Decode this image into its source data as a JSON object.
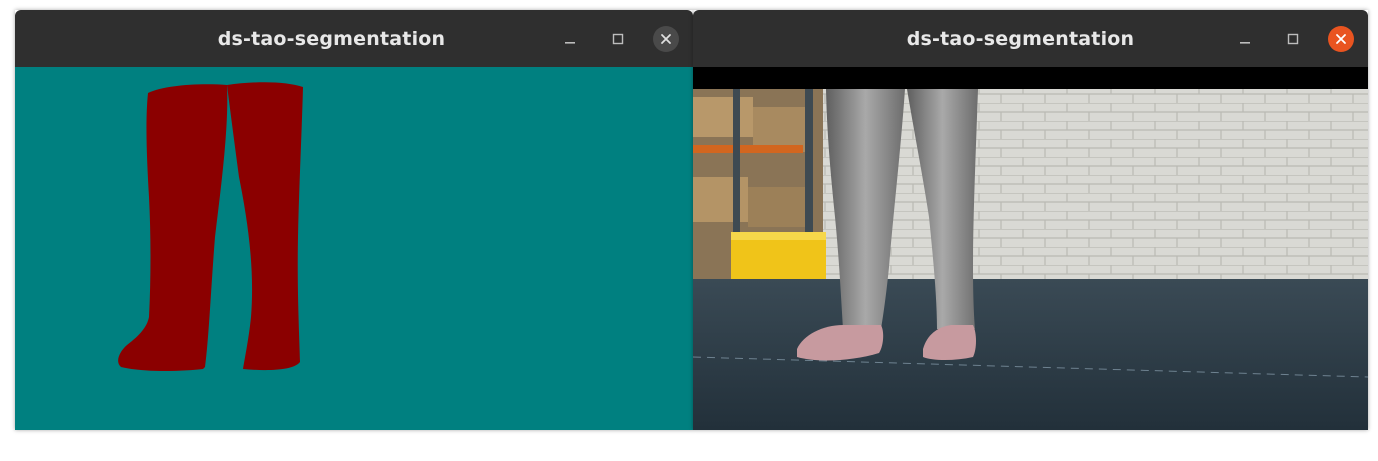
{
  "windows": [
    {
      "title": "ds-tao-segmentation",
      "view": "segmentation-mask",
      "background_color": "#008080",
      "mask_color": "#8b0000",
      "controls": {
        "minimize_icon": "minimize-icon",
        "maximize_icon": "maximize-icon",
        "close_icon": "close-icon"
      }
    },
    {
      "title": "ds-tao-segmentation",
      "view": "camera-frame",
      "close_color": "#e95420",
      "controls": {
        "minimize_icon": "minimize-icon",
        "maximize_icon": "maximize-icon",
        "close_icon": "close-icon"
      }
    }
  ],
  "colors": {
    "titlebar": "#2f2f2f",
    "title_text": "#e8e8e8",
    "close_active": "#e95420"
  }
}
